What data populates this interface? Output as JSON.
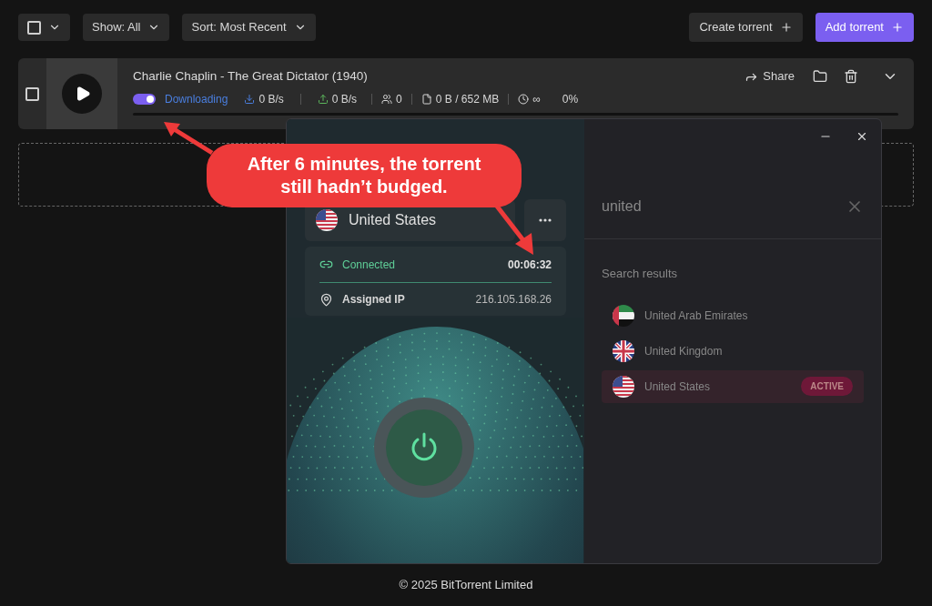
{
  "toolbar": {
    "select_all": {
      "checked": false
    },
    "show_filter": "Show: All",
    "sort": "Sort: Most Recent",
    "buttons": [
      {
        "label": "Create torrent",
        "kind": "secondary"
      },
      {
        "label": "Add torrent",
        "kind": "primary"
      }
    ]
  },
  "torrent": {
    "checked": false,
    "title": "Charlie Chaplin - The Great Dictator (1940)",
    "active": true,
    "status": "Downloading",
    "download": "0 B/s",
    "upload": "0 B/s",
    "peers": "0",
    "size": "0 B / 652 MB",
    "eta": "∞",
    "percent": "0%",
    "level": 0,
    "share": "Share"
  },
  "vpn": {
    "country": {
      "name": "United States",
      "kind": "us"
    },
    "connected": true,
    "status": "Connected",
    "duration": "00:06:32",
    "ip_label": "Assigned IP",
    "ip": "216.105.168.26",
    "search": {
      "value": "united"
    },
    "results_heading": "Search results",
    "results": [
      {
        "name": "United Arab Emirates",
        "kind": "uae",
        "selected": false
      },
      {
        "name": "United Kingdom",
        "kind": "uk",
        "selected": false
      },
      {
        "name": "United States",
        "kind": "us",
        "selected": true,
        "badge": "ACTIVE"
      }
    ]
  },
  "annotation": "After 6 minutes, the torrent still hadn’t budged.",
  "footer": "© 2025 BitTorrent Limited"
}
